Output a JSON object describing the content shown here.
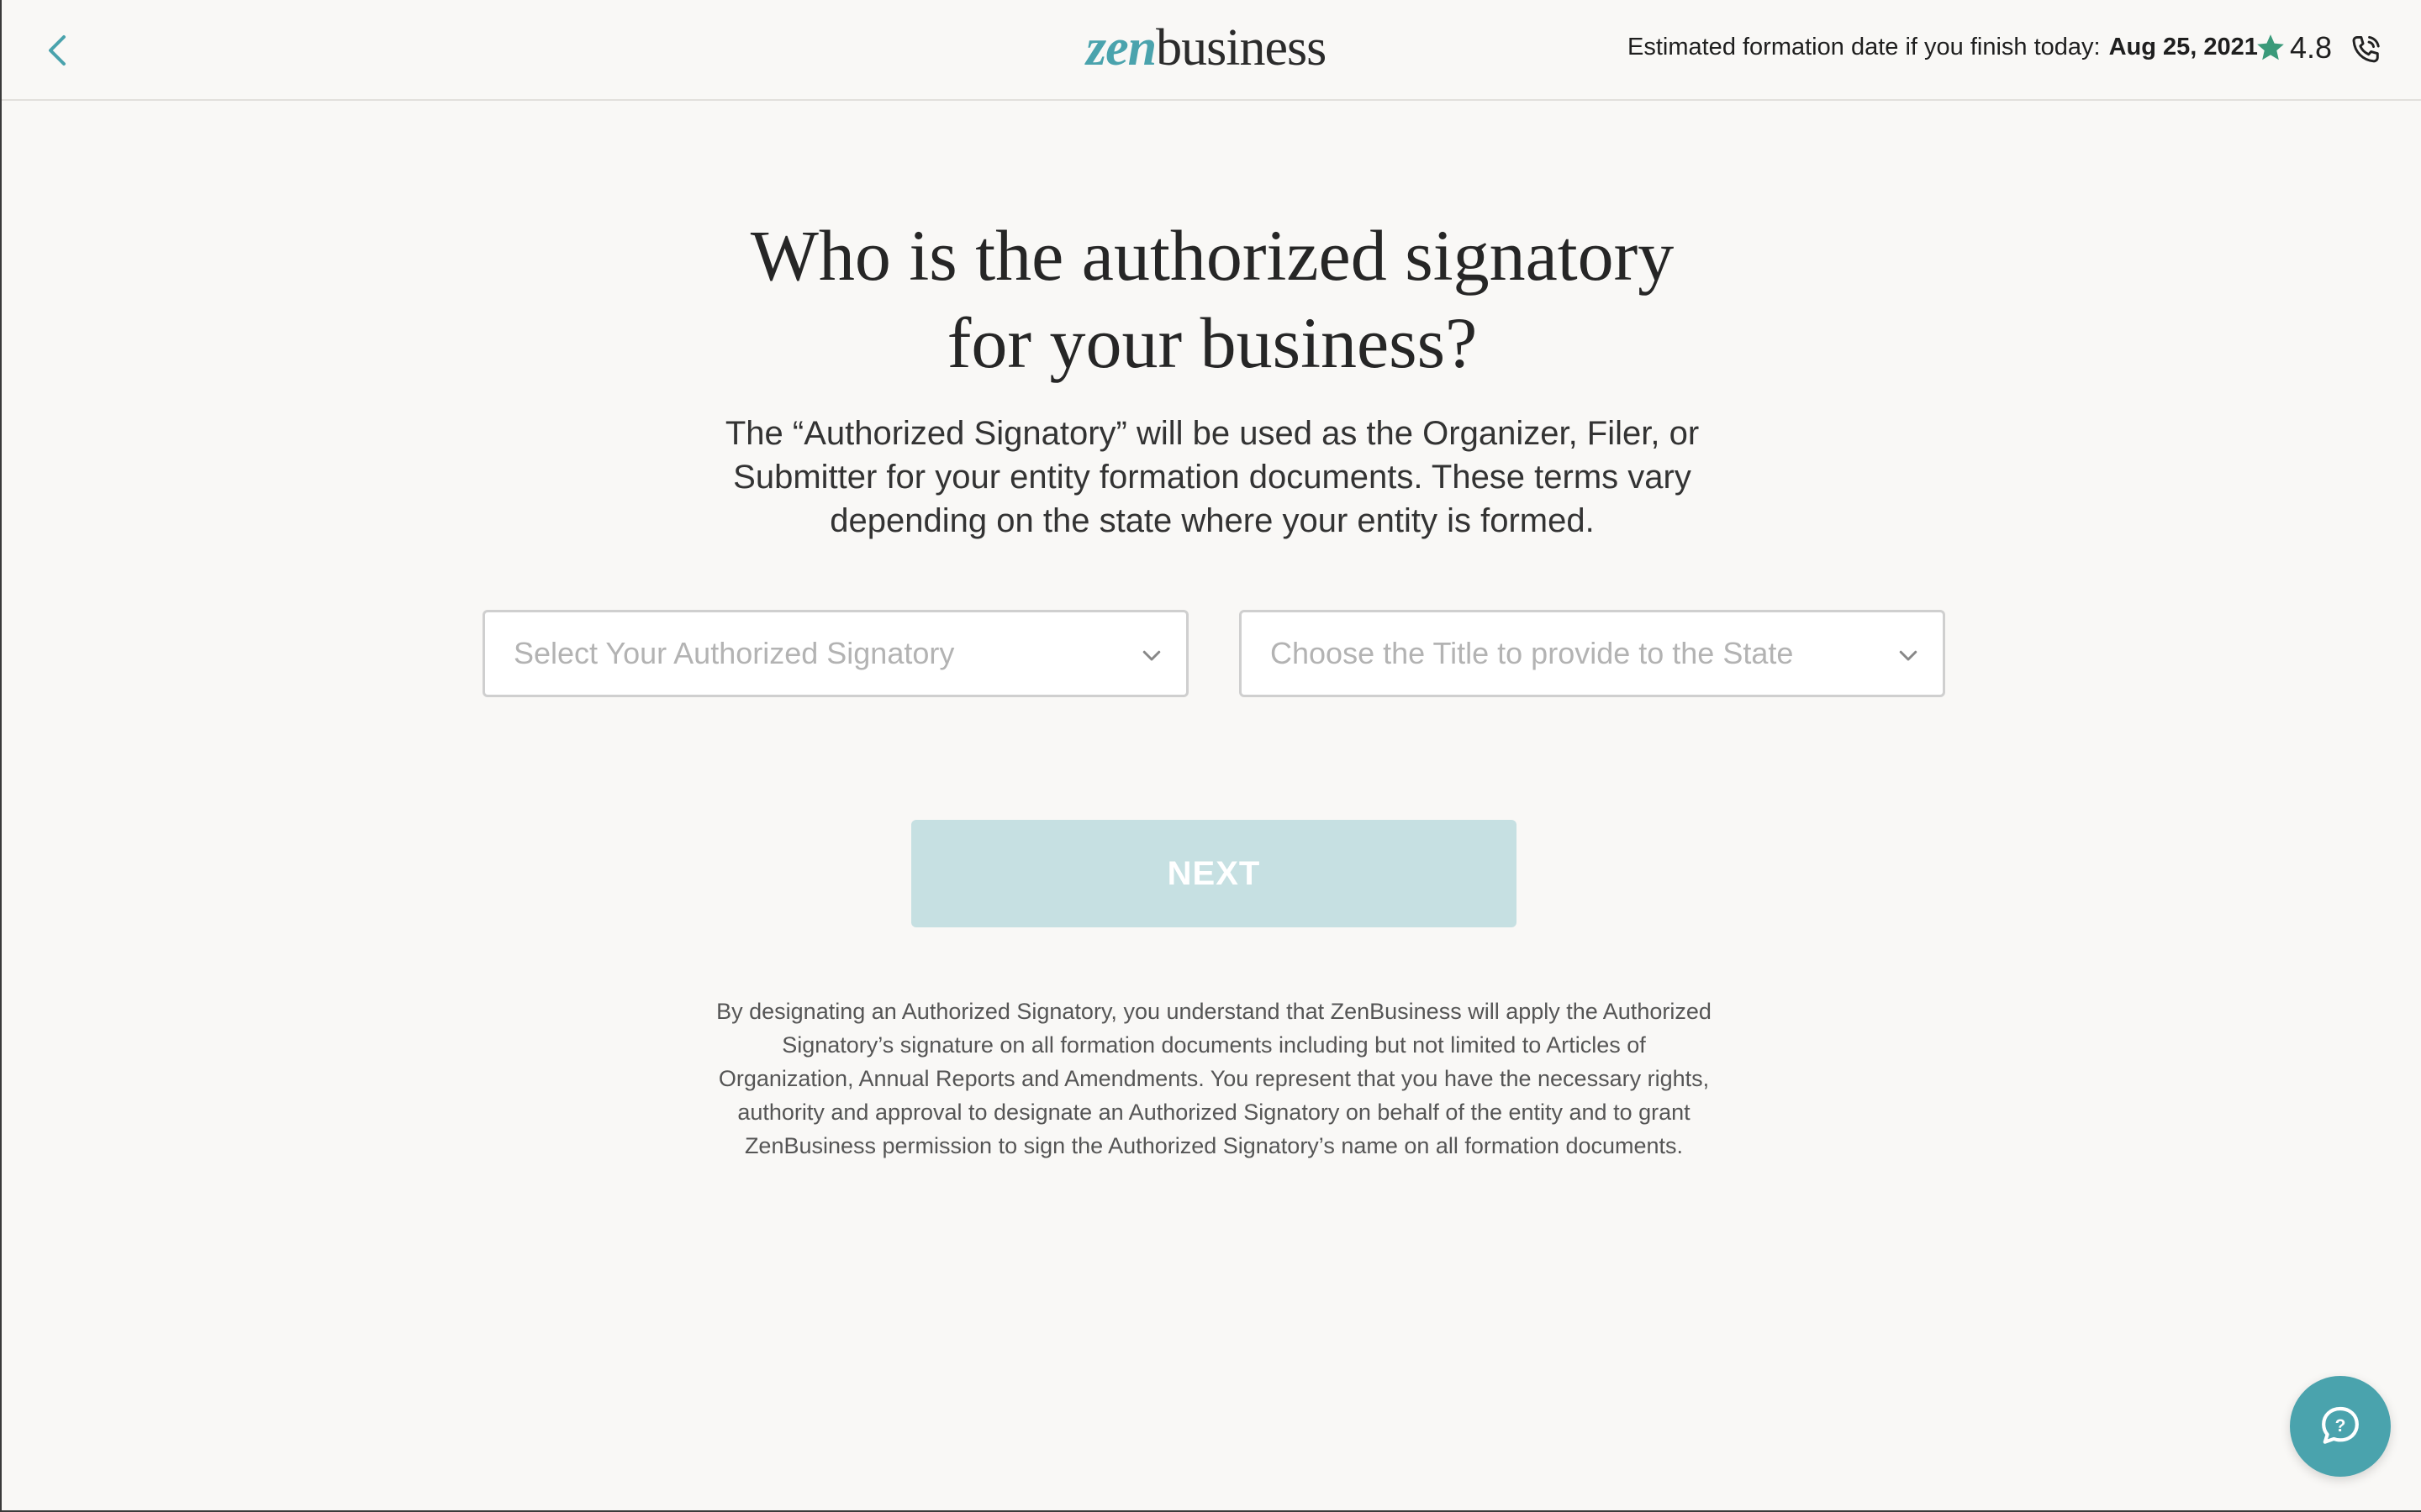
{
  "header": {
    "logo_zen": "zen",
    "logo_business": "business",
    "formation_label": "Estimated formation date if you finish today:",
    "formation_date": "Aug 25, 2021",
    "rating": "4.8"
  },
  "main": {
    "title_line1": "Who is the authorized signatory",
    "title_line2": "for your business?",
    "subtitle": "The “Authorized Signatory” will be used as the Organizer, Filer, or Submitter for your entity formation documents. These terms vary depending on the state where your entity is formed.",
    "signatory_select": {
      "placeholder": "Select Your Authorized Signatory"
    },
    "title_select": {
      "placeholder": "Choose the Title to provide to the State"
    },
    "next_label": "NEXT",
    "disclaimer": "By designating an Authorized Signatory, you understand that ZenBusiness will apply the Authorized Signatory’s signature on all formation documents including but not limited to Articles of Organization, Annual Reports and Amendments. You represent that you have the necessary rights, authority and approval to designate an Authorized Signatory on behalf of the entity and to grant ZenBusiness permission to sign the Authorized Signatory’s name on all formation documents."
  },
  "icons": {
    "back": "chevron-left-icon",
    "star": "star-icon",
    "phone": "phone-icon",
    "chevron": "chevron-down-icon",
    "chat": "chat-help-icon"
  },
  "colors": {
    "brand_teal": "#4aa3ad",
    "star_green": "#3a9a7a",
    "next_disabled": "#c6e0e2",
    "background": "#f9f8f6"
  }
}
